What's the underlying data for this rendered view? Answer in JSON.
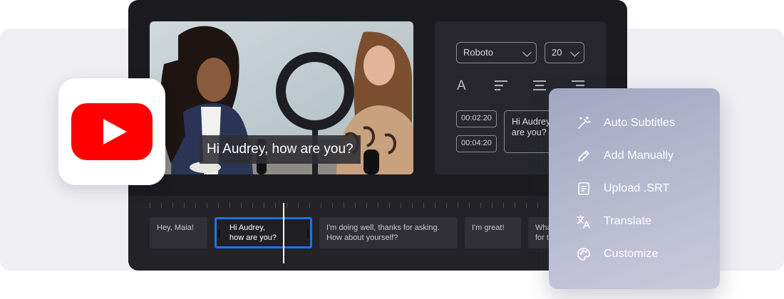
{
  "video": {
    "caption": "Hi Audrey, how are you?"
  },
  "style_panel": {
    "font_select": "Roboto",
    "size_select": "20",
    "text_icon_glyph": "A",
    "timecodes": [
      "00:02:20",
      "00:04:20"
    ],
    "subtitle_preview_lines": [
      "Hi Audrey,",
      "are you?"
    ]
  },
  "timeline": {
    "clips": [
      {
        "lines": [
          "Hey, Maia!"
        ],
        "active": false
      },
      {
        "lines": [
          "Hi Audrey,",
          "how are you?"
        ],
        "active": true
      },
      {
        "lines": [
          "I'm doing well, thanks for asking.",
          "How about yourself?"
        ],
        "active": false
      },
      {
        "lines": [
          "I'm great!"
        ],
        "active": false
      },
      {
        "lines": [
          "What",
          "for t"
        ],
        "active": false
      }
    ]
  },
  "menu": {
    "items": [
      {
        "label": "Auto Subtitles",
        "icon": "magic-wand-icon"
      },
      {
        "label": "Add Manually",
        "icon": "pencil-icon"
      },
      {
        "label": "Upload .SRT",
        "icon": "document-icon"
      },
      {
        "label": "Translate",
        "icon": "translate-icon"
      },
      {
        "label": "Customize",
        "icon": "palette-icon"
      }
    ]
  },
  "colors": {
    "accent": "#1c73e8",
    "youtube_red": "#ff0000",
    "editor_bg": "#1b1b1f"
  }
}
